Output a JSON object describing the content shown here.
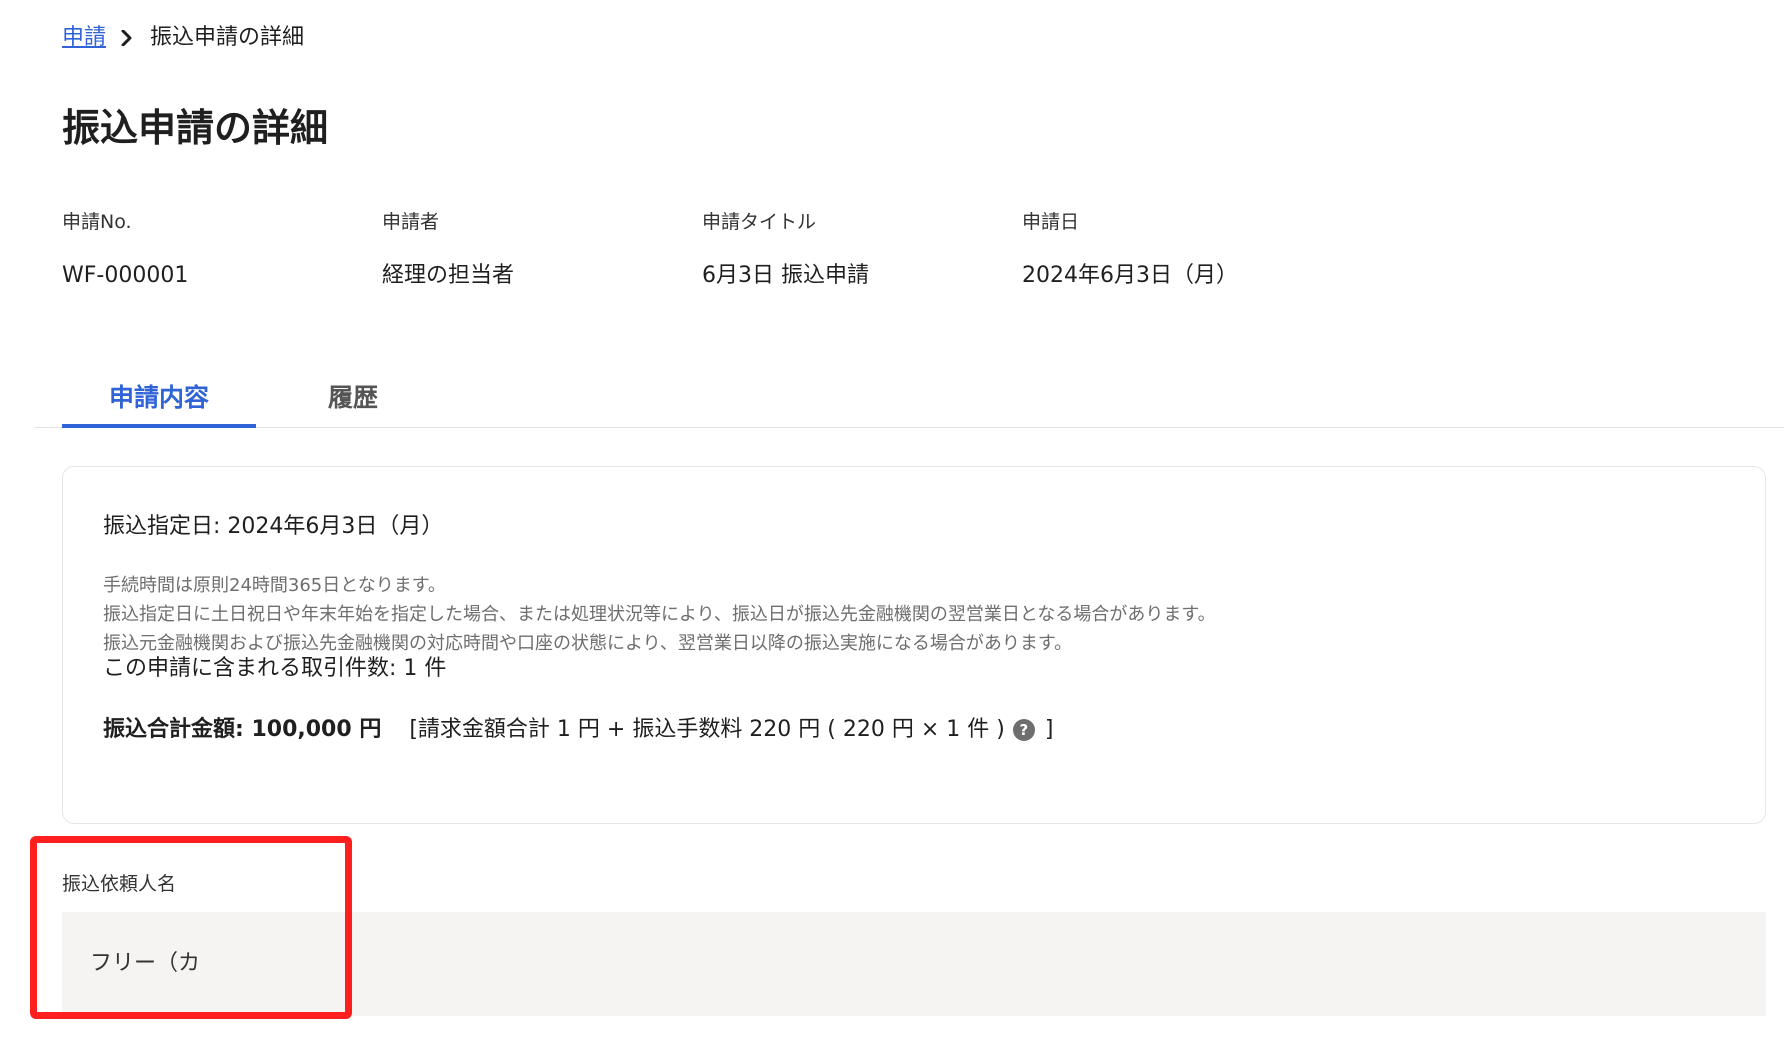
{
  "breadcrumb": {
    "parent": "申請",
    "current": "振込申請の詳細"
  },
  "page": {
    "title": "振込申請の詳細"
  },
  "meta": [
    {
      "label": "申請No.",
      "value": "WF-000001"
    },
    {
      "label": "申請者",
      "value": "経理の担当者"
    },
    {
      "label": "申請タイトル",
      "value": "6月3日 振込申請"
    },
    {
      "label": "申請日",
      "value": "2024年6月3日（月）"
    }
  ],
  "tabs": [
    {
      "label": "申請内容",
      "active": true
    },
    {
      "label": "履歴",
      "active": false
    }
  ],
  "card": {
    "designated_date": "振込指定日: 2024年6月3日（月）",
    "notes": [
      "手続時間は原則24時間365日となります。",
      "振込指定日に土日祝日や年末年始を指定した場合、または処理状況等により、振込日が振込先金融機関の翌営業日となる場合があります。",
      "振込元金融機関および振込先金融機関の対応時間や口座の状態により、翌営業日以降の振込実施になる場合があります。"
    ],
    "transaction_count": "この申請に含まれる取引件数: 1 件",
    "total_label": "振込合計金額: 100,000 円",
    "breakdown_prefix": "[請求金額合計 1 円 + 振込手数料 220 円 ( 220 円 × 1 件 )",
    "breakdown_suffix": "]",
    "help_glyph": "?"
  },
  "requester": {
    "label": "振込依頼人名",
    "value": "フリー（カ"
  },
  "colors": {
    "accent": "#2f63d6",
    "highlight": "#ff1f1f",
    "field_bg": "#f5f4f2"
  },
  "icons": {
    "breadcrumb_separator": "chevron-right-icon",
    "help": "help-circle-icon"
  }
}
